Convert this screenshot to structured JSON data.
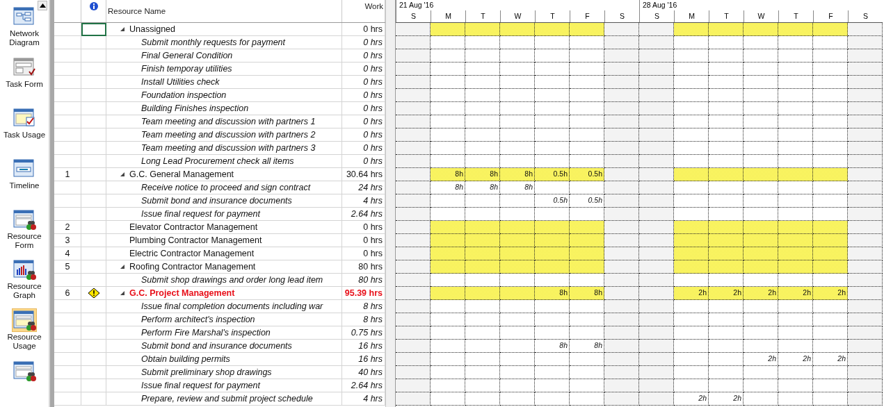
{
  "sidebar": {
    "items": [
      {
        "label": "Network Diagram",
        "selected": false
      },
      {
        "label": "Task Form",
        "selected": false
      },
      {
        "label": "Task Usage",
        "selected": false
      },
      {
        "label": "Timeline",
        "selected": false
      },
      {
        "label": "Resource Form",
        "selected": false
      },
      {
        "label": "Resource Graph",
        "selected": false
      },
      {
        "label": "Resource Usage",
        "selected": true
      },
      {
        "selected": false
      }
    ]
  },
  "table": {
    "columns": [
      "Resource Name",
      "Work"
    ],
    "rows": [
      {
        "name": "Unassigned",
        "work": "0 hrs",
        "kind": "resource",
        "expanded": true,
        "selected": true,
        "children": [
          {
            "name": "Submit monthly requests for payment",
            "work": "0 hrs",
            "kind": "assignment",
            "selected": false
          },
          {
            "name": "Final General Condition",
            "work": "0 hrs",
            "kind": "assignment",
            "selected": false
          },
          {
            "name": "Finish temporay utilities",
            "work": "0 hrs",
            "kind": "assignment",
            "selected": false
          },
          {
            "name": "Install Utilities check",
            "work": "0 hrs",
            "kind": "assignment",
            "selected": false
          },
          {
            "name": "Foundation inspection",
            "work": "0 hrs",
            "kind": "assignment",
            "selected": false
          },
          {
            "name": "Building Finishes inspection",
            "work": "0 hrs",
            "kind": "assignment",
            "selected": false
          },
          {
            "name": "Team meeting and discussion with partners 1",
            "work": "0 hrs",
            "kind": "assignment",
            "selected": false
          },
          {
            "name": "Team meeting and discussion with partners 2",
            "work": "0 hrs",
            "kind": "assignment",
            "selected": false
          },
          {
            "name": "Team meeting and discussion with partners 3",
            "work": "0 hrs",
            "kind": "assignment",
            "selected": false
          },
          {
            "name": "Long Lead Procurement check all items",
            "work": "0 hrs",
            "kind": "assignment",
            "selected": false
          }
        ]
      },
      {
        "id": "1",
        "name": "G.C. General Management",
        "work": "30.64 hrs",
        "kind": "resource",
        "expanded": true,
        "selected": false,
        "hours": {
          "d1": "8h",
          "d2": "8h",
          "d3": "8h",
          "d4": "0.5h",
          "d5": "0.5h"
        },
        "children": [
          {
            "name": "Receive notice to proceed and sign contract",
            "work": "24 hrs",
            "kind": "assignment",
            "selected": false,
            "hours": {
              "d1": "8h",
              "d2": "8h",
              "d3": "8h"
            }
          },
          {
            "name": "Submit bond and insurance documents",
            "work": "4 hrs",
            "kind": "assignment",
            "selected": false,
            "hours": {
              "d4": "0.5h",
              "d5": "0.5h"
            }
          },
          {
            "name": "Issue final request for payment",
            "work": "2.64 hrs",
            "kind": "assignment",
            "selected": false
          }
        ]
      },
      {
        "id": "2",
        "name": "Elevator Contractor Management",
        "work": "0 hrs",
        "kind": "resource",
        "selected": false
      },
      {
        "id": "3",
        "name": "Plumbing Contractor Management",
        "work": "0 hrs",
        "kind": "resource",
        "selected": false
      },
      {
        "id": "4",
        "name": "Electric Contractor Management",
        "work": "0 hrs",
        "kind": "resource",
        "selected": false
      },
      {
        "id": "5",
        "name": "Roofing Contractor Management",
        "work": "80 hrs",
        "kind": "resource",
        "expanded": true,
        "selected": false,
        "children": [
          {
            "name": "Submit shop drawings and order long lead item",
            "work": "80 hrs",
            "kind": "assignment",
            "selected": false
          }
        ]
      },
      {
        "id": "6",
        "warning": true,
        "name": "G.C. Project Management",
        "work": "95.39 hrs",
        "kind": "resource",
        "overallocated": true,
        "expanded": true,
        "selected": false,
        "hours": {
          "d4": "8h",
          "d5": "8h",
          "d8": "2h",
          "d9": "2h",
          "d10": "2h",
          "d11": "2h",
          "d12": "2h"
        },
        "children": [
          {
            "name": "Issue final completion documents including war",
            "work": "8 hrs",
            "kind": "assignment",
            "selected": false
          },
          {
            "name": "Perform architect's inspection",
            "work": "8 hrs",
            "kind": "assignment",
            "selected": false
          },
          {
            "name": "Perform Fire Marshal's inspection",
            "work": "0.75 hrs",
            "kind": "assignment",
            "selected": false
          },
          {
            "name": "Submit bond and insurance documents",
            "work": "16 hrs",
            "kind": "assignment",
            "selected": false,
            "hours": {
              "d4": "8h",
              "d5": "8h"
            }
          },
          {
            "name": "Obtain building permits",
            "work": "16 hrs",
            "kind": "assignment",
            "selected": false,
            "hours": {
              "d10": "2h",
              "d11": "2h",
              "d12": "2h"
            }
          },
          {
            "name": "Submit preliminary shop drawings",
            "work": "40 hrs",
            "kind": "assignment",
            "selected": false
          },
          {
            "name": "Issue final request for payment",
            "work": "2.64 hrs",
            "kind": "assignment",
            "selected": false
          },
          {
            "name": "Prepare, review and submit project schedule",
            "work": "4 hrs",
            "kind": "assignment",
            "selected": false,
            "hours": {
              "d8": "2h",
              "d9": "2h"
            }
          }
        ]
      }
    ]
  },
  "timescale": {
    "weeks": [
      "21 Aug '16",
      "28 Aug '16"
    ],
    "days": [
      {
        "label": "S",
        "weekend": true
      },
      {
        "label": "M",
        "weekend": false
      },
      {
        "label": "T",
        "weekend": false
      },
      {
        "label": "W",
        "weekend": false
      },
      {
        "label": "T",
        "weekend": false
      },
      {
        "label": "F",
        "weekend": false
      },
      {
        "label": "S",
        "weekend": true
      },
      {
        "label": "S",
        "weekend": true
      },
      {
        "label": "M",
        "weekend": false
      },
      {
        "label": "T",
        "weekend": false
      },
      {
        "label": "W",
        "weekend": false
      },
      {
        "label": "T",
        "weekend": false
      },
      {
        "label": "F",
        "weekend": false
      },
      {
        "label": "S",
        "weekend": true
      }
    ]
  }
}
